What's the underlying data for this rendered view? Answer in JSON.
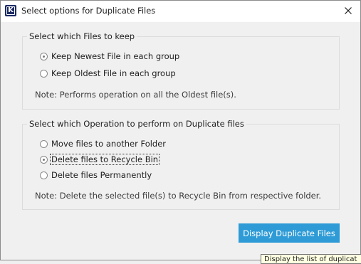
{
  "window": {
    "title": "Select options for Duplicate Files",
    "app_icon_letter": "K"
  },
  "keep_group": {
    "caption": "Select which Files to keep",
    "options": [
      {
        "label": "Keep Newest File in each group",
        "checked": true
      },
      {
        "label": "Keep Oldest File in each group",
        "checked": false
      }
    ],
    "note": "Note: Performs operation on all the Oldest file(s)."
  },
  "operation_group": {
    "caption": "Select which Operation to perform on Duplicate files",
    "options": [
      {
        "label": "Move files to another Folder",
        "checked": false
      },
      {
        "label": "Delete files to Recycle Bin",
        "checked": true
      },
      {
        "label": "Delete files Permanently",
        "checked": false
      }
    ],
    "note": "Note: Delete the selected file(s) to Recycle Bin from respective folder."
  },
  "actions": {
    "display_label": "Display Duplicate Files"
  },
  "tooltip": {
    "text": "Display the list of duplicat"
  },
  "colors": {
    "accent": "#2e9bd6",
    "icon_bg": "#1b2a63"
  }
}
